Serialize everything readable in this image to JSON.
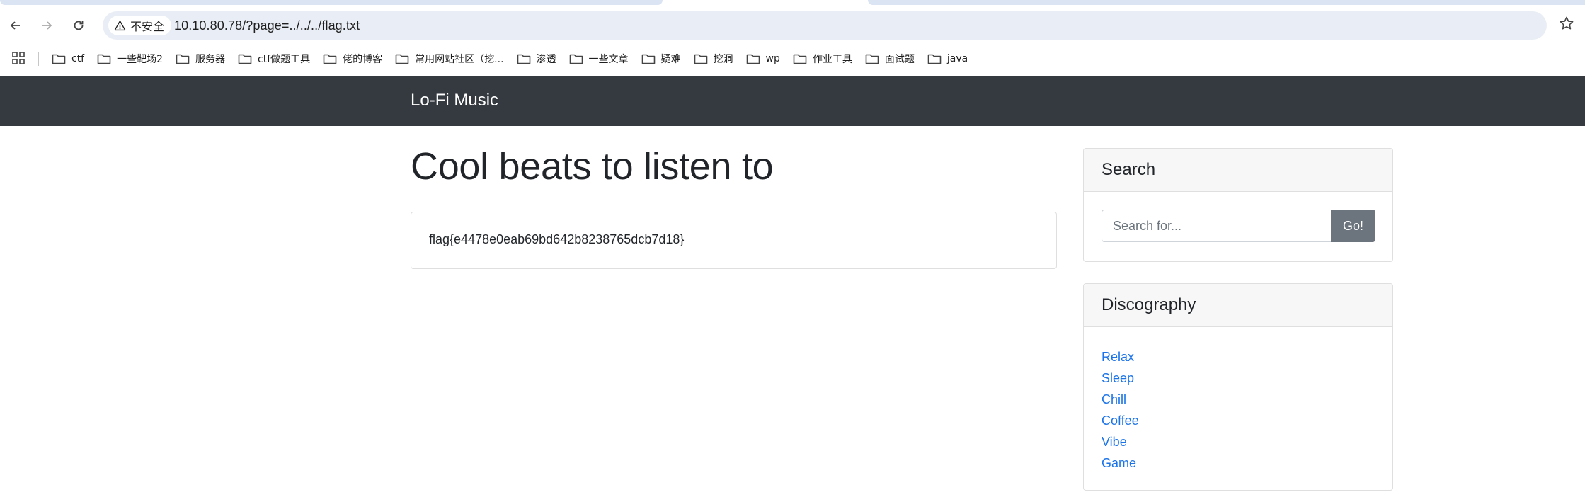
{
  "browser": {
    "url": "10.10.80.78/?page=../../../flag.txt",
    "security_label": "不安全",
    "bookmarks": [
      {
        "label": "ctf"
      },
      {
        "label": "一些靶场2"
      },
      {
        "label": "服务器"
      },
      {
        "label": "ctf做题工具"
      },
      {
        "label": "佬的博客"
      },
      {
        "label": "常用网站社区（挖..."
      },
      {
        "label": "渗透"
      },
      {
        "label": "一些文章"
      },
      {
        "label": "疑难"
      },
      {
        "label": "挖洞"
      },
      {
        "label": "wp"
      },
      {
        "label": "作业工具"
      },
      {
        "label": "面试题"
      },
      {
        "label": "java"
      }
    ]
  },
  "site": {
    "brand": "Lo-Fi Music"
  },
  "main": {
    "title": "Cool beats to listen to",
    "content": "flag{e4478e0eab69bd642b8238765dcb7d18}"
  },
  "sidebar": {
    "search": {
      "heading": "Search",
      "placeholder": "Search for...",
      "button": "Go!"
    },
    "discography": {
      "heading": "Discography",
      "items": [
        {
          "label": "Relax"
        },
        {
          "label": "Sleep"
        },
        {
          "label": "Chill"
        },
        {
          "label": "Coffee"
        },
        {
          "label": "Vibe"
        },
        {
          "label": "Game"
        }
      ]
    }
  },
  "colors": {
    "navbar": "#343a40",
    "link": "#1a73e8",
    "button": "#6c757d",
    "omnibox": "#e9eef6"
  }
}
